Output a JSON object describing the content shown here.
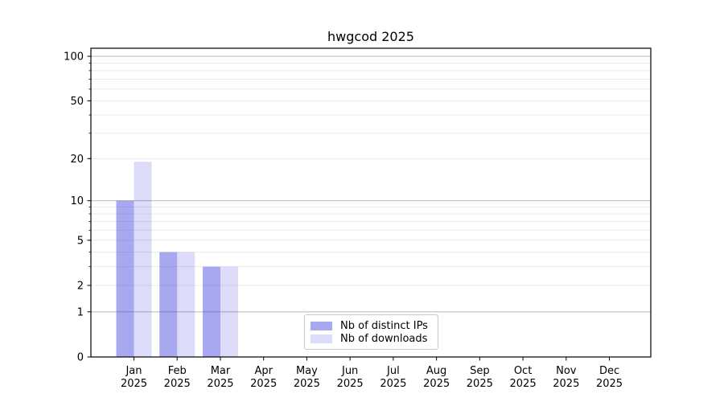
{
  "chart_data": {
    "type": "bar",
    "title": "hwgcod 2025",
    "categories": [
      "Jan",
      "Feb",
      "Mar",
      "Apr",
      "May",
      "Jun",
      "Jul",
      "Aug",
      "Sep",
      "Oct",
      "Nov",
      "Dec"
    ],
    "x_sublabel": "2025",
    "series": [
      {
        "name": "Nb of distinct IPs",
        "color": "rgba(47,47,221,0.42)",
        "approx_solid_color": "#a9a9f2",
        "values": [
          10,
          4,
          3,
          0,
          0,
          0,
          0,
          0,
          0,
          0,
          0,
          0
        ]
      },
      {
        "name": "Nb of downloads",
        "color": "rgba(47,47,221,0.17)",
        "approx_solid_color": "#dcdcfa",
        "values": [
          19,
          4,
          3,
          0,
          0,
          0,
          0,
          0,
          0,
          0,
          0,
          0
        ]
      }
    ],
    "yscale": "log1p",
    "ylim": [
      0,
      113
    ],
    "y_ticks": [
      0,
      1,
      2,
      5,
      10,
      20,
      50,
      100
    ],
    "y_major_gridlines": [
      1,
      10,
      100
    ],
    "y_minor_gridlines": [
      2,
      3,
      4,
      5,
      6,
      7,
      8,
      9,
      20,
      30,
      40,
      50,
      60,
      70,
      80,
      90
    ],
    "grid": true,
    "legend_position": "lower center",
    "colors": {
      "background": "#ffffff",
      "axis": "#000000",
      "text": "#000000",
      "major_grid": "#b9b9b9",
      "minor_grid": "#ebebeb",
      "legend_border": "#c9c9c9"
    }
  }
}
